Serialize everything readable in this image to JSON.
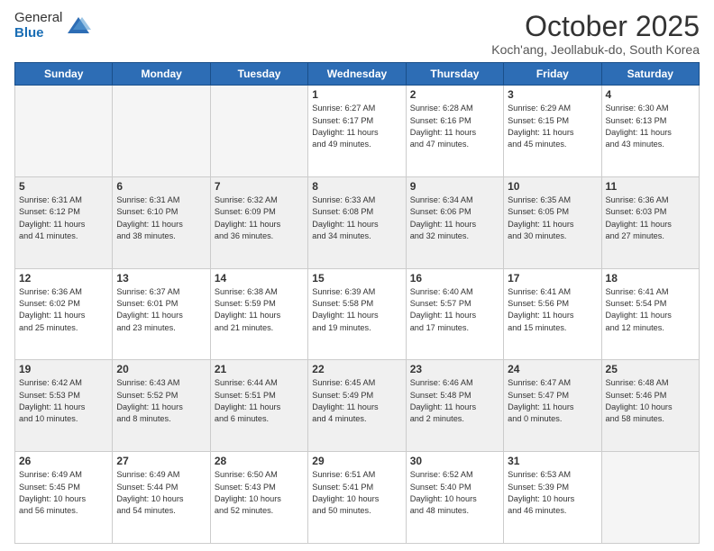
{
  "logo": {
    "general": "General",
    "blue": "Blue"
  },
  "title": "October 2025",
  "location": "Koch'ang, Jeollabuk-do, South Korea",
  "days_of_week": [
    "Sunday",
    "Monday",
    "Tuesday",
    "Wednesday",
    "Thursday",
    "Friday",
    "Saturday"
  ],
  "weeks": [
    [
      {
        "day": "",
        "info": ""
      },
      {
        "day": "",
        "info": ""
      },
      {
        "day": "",
        "info": ""
      },
      {
        "day": "1",
        "info": "Sunrise: 6:27 AM\nSunset: 6:17 PM\nDaylight: 11 hours\nand 49 minutes."
      },
      {
        "day": "2",
        "info": "Sunrise: 6:28 AM\nSunset: 6:16 PM\nDaylight: 11 hours\nand 47 minutes."
      },
      {
        "day": "3",
        "info": "Sunrise: 6:29 AM\nSunset: 6:15 PM\nDaylight: 11 hours\nand 45 minutes."
      },
      {
        "day": "4",
        "info": "Sunrise: 6:30 AM\nSunset: 6:13 PM\nDaylight: 11 hours\nand 43 minutes."
      }
    ],
    [
      {
        "day": "5",
        "info": "Sunrise: 6:31 AM\nSunset: 6:12 PM\nDaylight: 11 hours\nand 41 minutes."
      },
      {
        "day": "6",
        "info": "Sunrise: 6:31 AM\nSunset: 6:10 PM\nDaylight: 11 hours\nand 38 minutes."
      },
      {
        "day": "7",
        "info": "Sunrise: 6:32 AM\nSunset: 6:09 PM\nDaylight: 11 hours\nand 36 minutes."
      },
      {
        "day": "8",
        "info": "Sunrise: 6:33 AM\nSunset: 6:08 PM\nDaylight: 11 hours\nand 34 minutes."
      },
      {
        "day": "9",
        "info": "Sunrise: 6:34 AM\nSunset: 6:06 PM\nDaylight: 11 hours\nand 32 minutes."
      },
      {
        "day": "10",
        "info": "Sunrise: 6:35 AM\nSunset: 6:05 PM\nDaylight: 11 hours\nand 30 minutes."
      },
      {
        "day": "11",
        "info": "Sunrise: 6:36 AM\nSunset: 6:03 PM\nDaylight: 11 hours\nand 27 minutes."
      }
    ],
    [
      {
        "day": "12",
        "info": "Sunrise: 6:36 AM\nSunset: 6:02 PM\nDaylight: 11 hours\nand 25 minutes."
      },
      {
        "day": "13",
        "info": "Sunrise: 6:37 AM\nSunset: 6:01 PM\nDaylight: 11 hours\nand 23 minutes."
      },
      {
        "day": "14",
        "info": "Sunrise: 6:38 AM\nSunset: 5:59 PM\nDaylight: 11 hours\nand 21 minutes."
      },
      {
        "day": "15",
        "info": "Sunrise: 6:39 AM\nSunset: 5:58 PM\nDaylight: 11 hours\nand 19 minutes."
      },
      {
        "day": "16",
        "info": "Sunrise: 6:40 AM\nSunset: 5:57 PM\nDaylight: 11 hours\nand 17 minutes."
      },
      {
        "day": "17",
        "info": "Sunrise: 6:41 AM\nSunset: 5:56 PM\nDaylight: 11 hours\nand 15 minutes."
      },
      {
        "day": "18",
        "info": "Sunrise: 6:41 AM\nSunset: 5:54 PM\nDaylight: 11 hours\nand 12 minutes."
      }
    ],
    [
      {
        "day": "19",
        "info": "Sunrise: 6:42 AM\nSunset: 5:53 PM\nDaylight: 11 hours\nand 10 minutes."
      },
      {
        "day": "20",
        "info": "Sunrise: 6:43 AM\nSunset: 5:52 PM\nDaylight: 11 hours\nand 8 minutes."
      },
      {
        "day": "21",
        "info": "Sunrise: 6:44 AM\nSunset: 5:51 PM\nDaylight: 11 hours\nand 6 minutes."
      },
      {
        "day": "22",
        "info": "Sunrise: 6:45 AM\nSunset: 5:49 PM\nDaylight: 11 hours\nand 4 minutes."
      },
      {
        "day": "23",
        "info": "Sunrise: 6:46 AM\nSunset: 5:48 PM\nDaylight: 11 hours\nand 2 minutes."
      },
      {
        "day": "24",
        "info": "Sunrise: 6:47 AM\nSunset: 5:47 PM\nDaylight: 11 hours\nand 0 minutes."
      },
      {
        "day": "25",
        "info": "Sunrise: 6:48 AM\nSunset: 5:46 PM\nDaylight: 10 hours\nand 58 minutes."
      }
    ],
    [
      {
        "day": "26",
        "info": "Sunrise: 6:49 AM\nSunset: 5:45 PM\nDaylight: 10 hours\nand 56 minutes."
      },
      {
        "day": "27",
        "info": "Sunrise: 6:49 AM\nSunset: 5:44 PM\nDaylight: 10 hours\nand 54 minutes."
      },
      {
        "day": "28",
        "info": "Sunrise: 6:50 AM\nSunset: 5:43 PM\nDaylight: 10 hours\nand 52 minutes."
      },
      {
        "day": "29",
        "info": "Sunrise: 6:51 AM\nSunset: 5:41 PM\nDaylight: 10 hours\nand 50 minutes."
      },
      {
        "day": "30",
        "info": "Sunrise: 6:52 AM\nSunset: 5:40 PM\nDaylight: 10 hours\nand 48 minutes."
      },
      {
        "day": "31",
        "info": "Sunrise: 6:53 AM\nSunset: 5:39 PM\nDaylight: 10 hours\nand 46 minutes."
      },
      {
        "day": "",
        "info": ""
      }
    ]
  ]
}
